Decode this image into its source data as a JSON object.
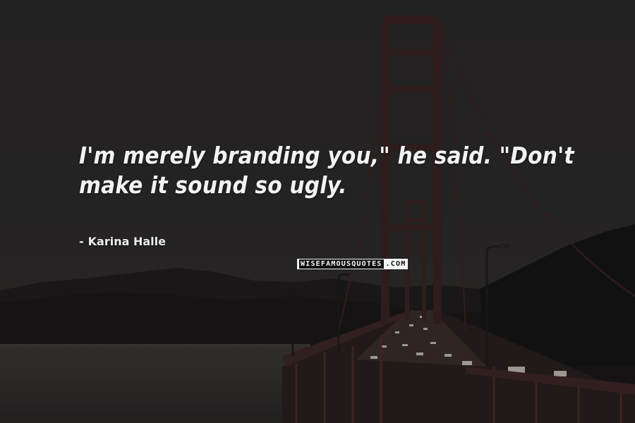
{
  "quote": {
    "line1": "I'm merely branding you,\" he said. \"Don't",
    "line2": "make it sound so ugly."
  },
  "author": {
    "dash": "-",
    "name": "Karina Halle"
  },
  "watermark": {
    "main": "WISEFAMOUSQUOTES",
    "tld": ".COM"
  },
  "colors": {
    "sky": "#2b2929",
    "bridge": "#3a2424",
    "text": "#f2f2f2"
  }
}
